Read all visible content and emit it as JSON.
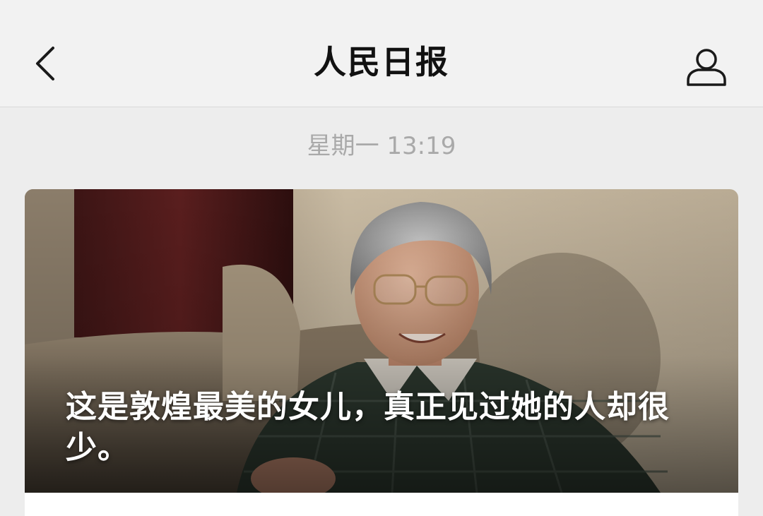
{
  "nav": {
    "title": "人民日报",
    "back_icon": "chevron-left-icon",
    "profile_icon": "person-icon"
  },
  "timestamp": "星期一 13:19",
  "article": {
    "cover_title": "这是敦煌最美的女儿，真正见过她的人却很少。"
  },
  "colors": {
    "nav_background": "#f2f2f2",
    "page_background": "#ededed",
    "timestamp_text": "#a9a9a9",
    "title_text": "#111111"
  }
}
